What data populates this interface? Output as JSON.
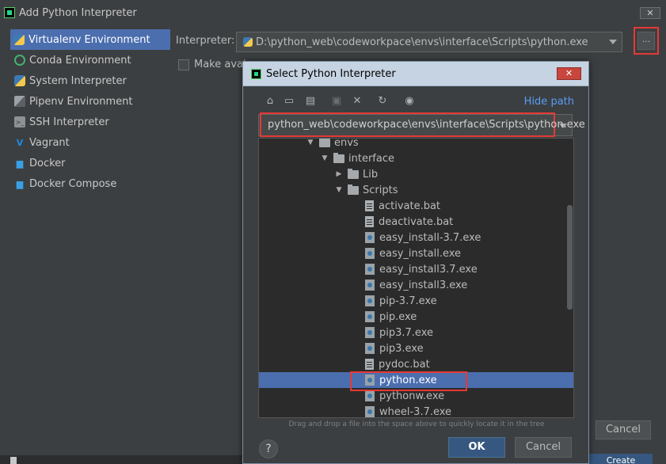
{
  "window": {
    "title": "Add Python Interpreter",
    "close_label": "✕"
  },
  "sidebar": {
    "items": [
      {
        "label": "Virtualenv Environment",
        "icon": "python-icon"
      },
      {
        "label": "Conda Environment",
        "icon": "conda-icon"
      },
      {
        "label": "System Interpreter",
        "icon": "python-icon"
      },
      {
        "label": "Pipenv Environment",
        "icon": "pipenv-icon"
      },
      {
        "label": "SSH Interpreter",
        "icon": "ssh-icon"
      },
      {
        "label": "Vagrant",
        "icon": "vagrant-icon"
      },
      {
        "label": "Docker",
        "icon": "docker-icon"
      },
      {
        "label": "Docker Compose",
        "icon": "docker-icon"
      }
    ]
  },
  "main": {
    "interpreter_label": "Interpreter:",
    "interpreter_value": "D:\\python_web\\codeworkpace\\envs\\interface\\Scripts\\python.exe",
    "browse_label": "...",
    "make_available_label": "Make avai",
    "cancel_label": "Cancel",
    "create_label": "Create"
  },
  "dialog": {
    "title": "Select Python Interpreter",
    "close_label": "✕",
    "hide_path": "Hide path",
    "path_value": "python_web\\codeworkpace\\envs\\interface\\Scripts\\python.exe",
    "tree": [
      {
        "label": "envs",
        "type": "folder",
        "expanded": true
      },
      {
        "label": "interface",
        "type": "folder",
        "expanded": true
      },
      {
        "label": "Lib",
        "type": "folder",
        "expanded": false
      },
      {
        "label": "Scripts",
        "type": "folder",
        "expanded": true
      },
      {
        "label": "activate.bat",
        "type": "file"
      },
      {
        "label": "deactivate.bat",
        "type": "file"
      },
      {
        "label": "easy_install-3.7.exe",
        "type": "exe"
      },
      {
        "label": "easy_install.exe",
        "type": "exe"
      },
      {
        "label": "easy_install3.7.exe",
        "type": "exe"
      },
      {
        "label": "easy_install3.exe",
        "type": "exe"
      },
      {
        "label": "pip-3.7.exe",
        "type": "exe"
      },
      {
        "label": "pip.exe",
        "type": "exe"
      },
      {
        "label": "pip3.7.exe",
        "type": "exe"
      },
      {
        "label": "pip3.exe",
        "type": "exe"
      },
      {
        "label": "pydoc.bat",
        "type": "file"
      },
      {
        "label": "python.exe",
        "type": "exe",
        "selected": true
      },
      {
        "label": "pythonw.exe",
        "type": "exe"
      },
      {
        "label": "wheel-3.7.exe",
        "type": "exe"
      }
    ],
    "hint": "Drag and drop a file into the space above to quickly locate it in the tree",
    "help_label": "?",
    "ok_label": "OK",
    "cancel_label": "Cancel"
  },
  "colors": {
    "selection": "#4b6eaf",
    "highlight_box": "#e53935",
    "link": "#589df6",
    "primary_button": "#365880"
  }
}
